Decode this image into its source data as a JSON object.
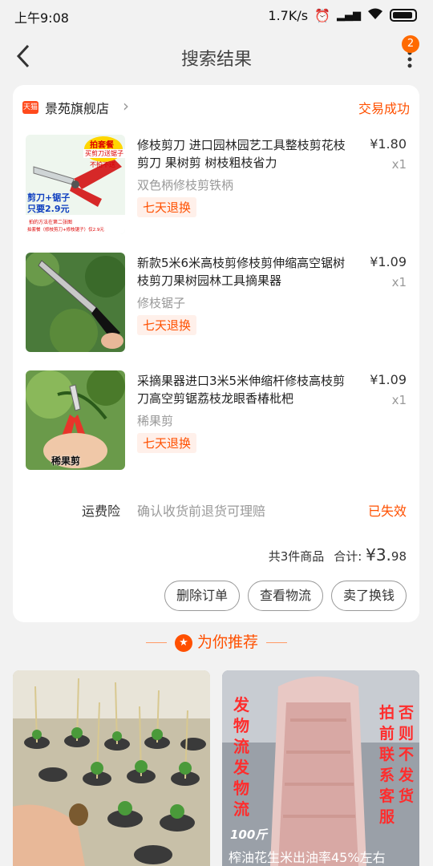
{
  "status_bar": {
    "time": "上午9:08",
    "speed": "1.7K/s"
  },
  "nav": {
    "title": "搜索结果",
    "badge": "2"
  },
  "shop": {
    "icon_text": "天猫",
    "name": "景苑旗舰店",
    "order_status": "交易成功"
  },
  "items": [
    {
      "title": "修枝剪刀 进口园林园艺工具整枝剪花枝剪刀 果树剪 树枝粗枝省力",
      "sku": "双色柄修枝剪铁柄",
      "tag": "七天退换",
      "price": "¥1.80",
      "qty": "x1",
      "thumb_text": {
        "top": "拍套餐",
        "promo": "买剪刀送锯子",
        "promo2": "不拍不送",
        "bottom1": "剪刀+锯子",
        "bottom2": "只要2.9元",
        "foot": "拍的方法在第二张图",
        "foot2": "拍套餐（修枝剪刀+修枝锯子）仅2.9元"
      }
    },
    {
      "title": "新款5米6米高枝剪修枝剪伸缩高空锯树枝剪刀果树园林工具摘果器",
      "sku": "修枝锯子",
      "tag": "七天退换",
      "price": "¥1.09",
      "qty": "x1"
    },
    {
      "title": "采摘果器进口3米5米伸缩杆修枝高枝剪刀高空剪锯荔枝龙眼香椿枇杷",
      "sku": "稀果剪",
      "tag": "七天退换",
      "price": "¥1.09",
      "qty": "x1",
      "thumb_text": {
        "caption": "稀果剪"
      }
    }
  ],
  "insurance": {
    "label": "运费险",
    "desc": "确认收货前退货可理赔",
    "status": "已失效"
  },
  "summary": {
    "count": "共3件商品",
    "total_label": "合计:",
    "total_main": "¥3.",
    "total_cents": "98"
  },
  "actions": {
    "delete": "删除订单",
    "logistics": "查看物流",
    "resell": "卖了换钱"
  },
  "recommend": {
    "title": "为你推荐"
  },
  "rec_cards": [
    {
      "name": "seedlings"
    },
    {
      "overlay_left1": "发物流",
      "overlay_left2": "发物流",
      "overlay_right1": "否则不发货",
      "overlay_right2": "拍前联系客服",
      "weight": "100斤",
      "caption": "榨油花生米出油率45%左右"
    }
  ],
  "colors": {
    "accent": "#ff5000",
    "badge": "#ff6a00"
  }
}
